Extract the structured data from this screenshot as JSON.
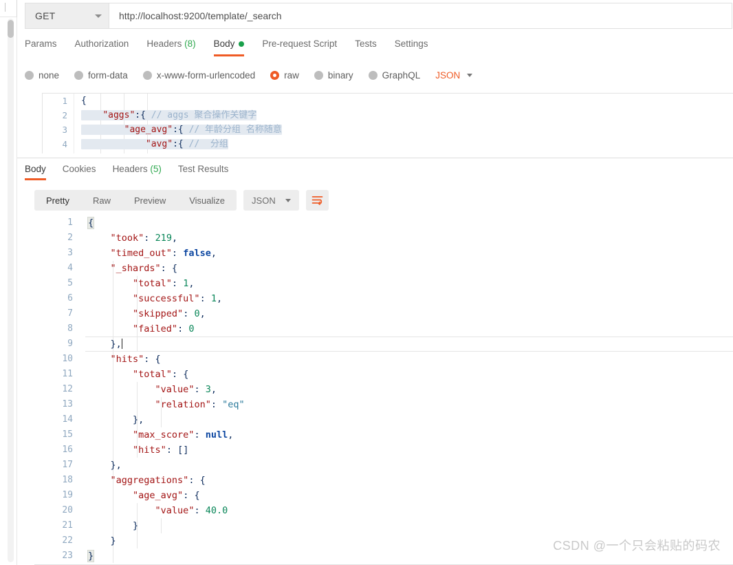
{
  "request": {
    "method": "GET",
    "url": "http://localhost:9200/template/_search",
    "tabs": [
      {
        "label": "Params",
        "active": false
      },
      {
        "label": "Authorization",
        "active": false
      },
      {
        "label": "Headers",
        "count": "(8)",
        "active": false
      },
      {
        "label": "Body",
        "active": true,
        "dot": true
      },
      {
        "label": "Pre-request Script",
        "active": false
      },
      {
        "label": "Tests",
        "active": false
      },
      {
        "label": "Settings",
        "active": false
      }
    ],
    "body_types": [
      {
        "label": "none",
        "selected": false
      },
      {
        "label": "form-data",
        "selected": false
      },
      {
        "label": "x-www-form-urlencoded",
        "selected": false
      },
      {
        "label": "raw",
        "selected": true
      },
      {
        "label": "binary",
        "selected": false
      },
      {
        "label": "GraphQL",
        "selected": false
      }
    ],
    "format": "JSON",
    "editor_lines": [
      {
        "n": "1",
        "segments": [
          {
            "t": "{",
            "c": "pn"
          }
        ]
      },
      {
        "n": "2",
        "segments": [
          {
            "t": "    ",
            "c": "pn"
          },
          {
            "t": "\"aggs\"",
            "c": "k"
          },
          {
            "t": ":{ ",
            "c": "pn"
          },
          {
            "t": "// aggs 聚合操作关键字",
            "c": "cm"
          }
        ]
      },
      {
        "n": "3",
        "segments": [
          {
            "t": "        ",
            "c": "pn"
          },
          {
            "t": "\"age_avg\"",
            "c": "k"
          },
          {
            "t": ":{ ",
            "c": "pn"
          },
          {
            "t": "// 年龄分组 名称随意",
            "c": "cm"
          }
        ]
      },
      {
        "n": "4",
        "segments": [
          {
            "t": "            ",
            "c": "pn"
          },
          {
            "t": "\"avg\"",
            "c": "k"
          },
          {
            "t": ":{ ",
            "c": "pn"
          },
          {
            "t": "//  分组",
            "c": "cm"
          }
        ]
      }
    ]
  },
  "response": {
    "tabs": [
      {
        "label": "Body",
        "active": true
      },
      {
        "label": "Cookies",
        "active": false
      },
      {
        "label": "Headers",
        "count": "(5)",
        "active": false
      },
      {
        "label": "Test Results",
        "active": false
      }
    ],
    "view_modes": [
      {
        "label": "Pretty",
        "active": true
      },
      {
        "label": "Raw",
        "active": false
      },
      {
        "label": "Preview",
        "active": false
      },
      {
        "label": "Visualize",
        "active": false
      }
    ],
    "format": "JSON",
    "wrap_icon": "wrap-text-icon",
    "body_lines": [
      {
        "n": "1",
        "active": false,
        "segments": [
          {
            "t": "{",
            "c": "pn match"
          }
        ]
      },
      {
        "n": "2",
        "active": false,
        "segments": [
          {
            "t": "    ",
            "c": "pn"
          },
          {
            "t": "\"took\"",
            "c": "k"
          },
          {
            "t": ": ",
            "c": "pn"
          },
          {
            "t": "219",
            "c": "num"
          },
          {
            "t": ",",
            "c": "pn"
          }
        ]
      },
      {
        "n": "3",
        "active": false,
        "segments": [
          {
            "t": "    ",
            "c": "pn"
          },
          {
            "t": "\"timed_out\"",
            "c": "k"
          },
          {
            "t": ": ",
            "c": "pn"
          },
          {
            "t": "false",
            "c": "bool"
          },
          {
            "t": ",",
            "c": "pn"
          }
        ]
      },
      {
        "n": "4",
        "active": false,
        "segments": [
          {
            "t": "    ",
            "c": "pn"
          },
          {
            "t": "\"_shards\"",
            "c": "k"
          },
          {
            "t": ": {",
            "c": "pn"
          }
        ]
      },
      {
        "n": "5",
        "active": false,
        "segments": [
          {
            "t": "        ",
            "c": "pn"
          },
          {
            "t": "\"total\"",
            "c": "k"
          },
          {
            "t": ": ",
            "c": "pn"
          },
          {
            "t": "1",
            "c": "num"
          },
          {
            "t": ",",
            "c": "pn"
          }
        ]
      },
      {
        "n": "6",
        "active": false,
        "segments": [
          {
            "t": "        ",
            "c": "pn"
          },
          {
            "t": "\"successful\"",
            "c": "k"
          },
          {
            "t": ": ",
            "c": "pn"
          },
          {
            "t": "1",
            "c": "num"
          },
          {
            "t": ",",
            "c": "pn"
          }
        ]
      },
      {
        "n": "7",
        "active": false,
        "segments": [
          {
            "t": "        ",
            "c": "pn"
          },
          {
            "t": "\"skipped\"",
            "c": "k"
          },
          {
            "t": ": ",
            "c": "pn"
          },
          {
            "t": "0",
            "c": "num"
          },
          {
            "t": ",",
            "c": "pn"
          }
        ]
      },
      {
        "n": "8",
        "active": false,
        "segments": [
          {
            "t": "        ",
            "c": "pn"
          },
          {
            "t": "\"failed\"",
            "c": "k"
          },
          {
            "t": ": ",
            "c": "pn"
          },
          {
            "t": "0",
            "c": "num"
          }
        ]
      },
      {
        "n": "9",
        "active": true,
        "caret": true,
        "segments": [
          {
            "t": "    ",
            "c": "pn"
          },
          {
            "t": "},",
            "c": "pn"
          }
        ]
      },
      {
        "n": "10",
        "active": false,
        "segments": [
          {
            "t": "    ",
            "c": "pn"
          },
          {
            "t": "\"hits\"",
            "c": "k"
          },
          {
            "t": ": {",
            "c": "pn"
          }
        ]
      },
      {
        "n": "11",
        "active": false,
        "segments": [
          {
            "t": "        ",
            "c": "pn"
          },
          {
            "t": "\"total\"",
            "c": "k"
          },
          {
            "t": ": {",
            "c": "pn"
          }
        ]
      },
      {
        "n": "12",
        "active": false,
        "segments": [
          {
            "t": "            ",
            "c": "pn"
          },
          {
            "t": "\"value\"",
            "c": "k"
          },
          {
            "t": ": ",
            "c": "pn"
          },
          {
            "t": "3",
            "c": "num"
          },
          {
            "t": ",",
            "c": "pn"
          }
        ]
      },
      {
        "n": "13",
        "active": false,
        "segments": [
          {
            "t": "            ",
            "c": "pn"
          },
          {
            "t": "\"relation\"",
            "c": "k"
          },
          {
            "t": ": ",
            "c": "pn"
          },
          {
            "t": "\"eq\"",
            "c": "str"
          }
        ]
      },
      {
        "n": "14",
        "active": false,
        "segments": [
          {
            "t": "        ",
            "c": "pn"
          },
          {
            "t": "},",
            "c": "pn"
          }
        ]
      },
      {
        "n": "15",
        "active": false,
        "segments": [
          {
            "t": "        ",
            "c": "pn"
          },
          {
            "t": "\"max_score\"",
            "c": "k"
          },
          {
            "t": ": ",
            "c": "pn"
          },
          {
            "t": "null",
            "c": "bool"
          },
          {
            "t": ",",
            "c": "pn"
          }
        ]
      },
      {
        "n": "16",
        "active": false,
        "segments": [
          {
            "t": "        ",
            "c": "pn"
          },
          {
            "t": "\"hits\"",
            "c": "k"
          },
          {
            "t": ": []",
            "c": "pn"
          }
        ]
      },
      {
        "n": "17",
        "active": false,
        "segments": [
          {
            "t": "    ",
            "c": "pn"
          },
          {
            "t": "},",
            "c": "pn"
          }
        ]
      },
      {
        "n": "18",
        "active": false,
        "segments": [
          {
            "t": "    ",
            "c": "pn"
          },
          {
            "t": "\"aggregations\"",
            "c": "k"
          },
          {
            "t": ": {",
            "c": "pn"
          }
        ]
      },
      {
        "n": "19",
        "active": false,
        "segments": [
          {
            "t": "        ",
            "c": "pn"
          },
          {
            "t": "\"age_avg\"",
            "c": "k"
          },
          {
            "t": ": {",
            "c": "pn"
          }
        ]
      },
      {
        "n": "20",
        "active": false,
        "segments": [
          {
            "t": "            ",
            "c": "pn"
          },
          {
            "t": "\"value\"",
            "c": "k"
          },
          {
            "t": ": ",
            "c": "pn"
          },
          {
            "t": "40.0",
            "c": "num"
          }
        ]
      },
      {
        "n": "21",
        "active": false,
        "segments": [
          {
            "t": "        ",
            "c": "pn"
          },
          {
            "t": "}",
            "c": "pn"
          }
        ]
      },
      {
        "n": "22",
        "active": false,
        "segments": [
          {
            "t": "    ",
            "c": "pn"
          },
          {
            "t": "}",
            "c": "pn"
          }
        ]
      },
      {
        "n": "23",
        "active": false,
        "segments": [
          {
            "t": "}",
            "c": "pn match"
          }
        ]
      }
    ]
  },
  "watermark": "CSDN @一个只会粘贴的码农",
  "colors": {
    "accent": "#ef5b25",
    "green": "#19a04b",
    "gutter_number": "#8fa8c0"
  }
}
